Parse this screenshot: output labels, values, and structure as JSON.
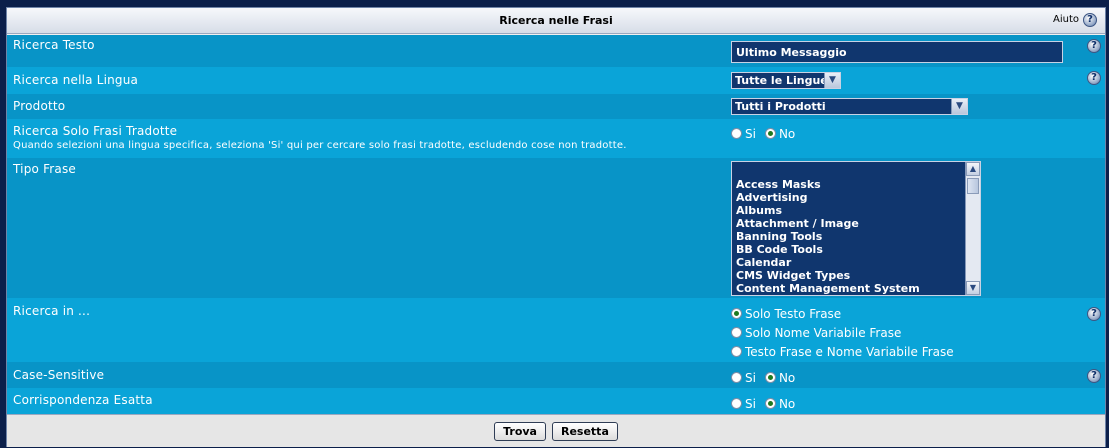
{
  "header": {
    "title": "Ricerca nelle Frasi",
    "help_label": "Aiuto",
    "help_icon": "question-mark-icon"
  },
  "fields": {
    "search_text": {
      "label": "Ricerca Testo",
      "value": "Ultimo Messaggio"
    },
    "language": {
      "label": "Ricerca nella Lingua",
      "selected": "Tutte le Lingue"
    },
    "product": {
      "label": "Prodotto",
      "selected": "Tutti i Prodotti"
    },
    "translated_only": {
      "label": "Ricerca Solo Frasi Tradotte",
      "description": "Quando selezioni una lingua specifica, seleziona 'Si' qui per cercare solo frasi tradotte, escludendo cose non tradotte.",
      "options": [
        "Si",
        "No"
      ],
      "selected": "No"
    },
    "phrase_type": {
      "label": "Tipo Frase",
      "items": [
        "Access Masks",
        "Advertising",
        "Albums",
        "Attachment / Image",
        "Banning Tools",
        "BB Code Tools",
        "Calendar",
        "CMS Widget Types",
        "Content Management System"
      ]
    },
    "search_in": {
      "label": "Ricerca in ...",
      "options": [
        "Solo Testo Frase",
        "Solo Nome Variabile Frase",
        "Testo Frase e Nome Variabile Frase"
      ],
      "selected": "Solo Testo Frase"
    },
    "case_sensitive": {
      "label": "Case-Sensitive",
      "options": [
        "Si",
        "No"
      ],
      "selected": "No"
    },
    "exact_match": {
      "label": "Corrispondenza Esatta",
      "options": [
        "Si",
        "No"
      ],
      "selected": "No"
    }
  },
  "buttons": {
    "submit": "Trova",
    "reset": "Resetta"
  },
  "colors": {
    "row_dark": "#0894c7",
    "row_light": "#0aa4d8",
    "input_bg": "#10366e",
    "frame": "#0b1f4a"
  }
}
